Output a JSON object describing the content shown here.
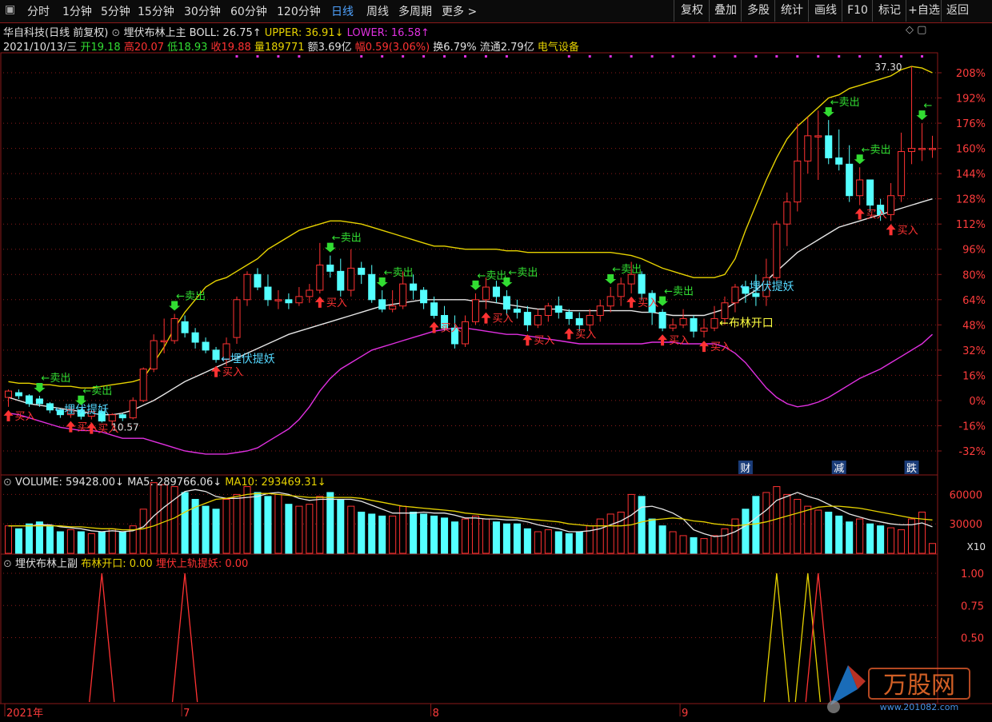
{
  "toolbar": {
    "periods": [
      "分时",
      "1分钟",
      "5分钟",
      "15分钟",
      "30分钟",
      "60分钟",
      "120分钟",
      "日线",
      "周线",
      "多周期",
      "更多 >"
    ],
    "active": "日线",
    "right": [
      "复权",
      "叠加",
      "多股",
      "统计",
      "画线",
      "F10",
      "标记",
      "+自选",
      "返回"
    ]
  },
  "header": {
    "stock": "华自科技(日线 前复权)",
    "indicator": "埋伏布林上主",
    "boll": "BOLL: 26.75↑",
    "upper": "UPPER: 36.91↓",
    "lower": "LOWER: 16.58↑",
    "date": "2021/10/13/三",
    "open": "开19.18",
    "high": "高20.07",
    "low": "低18.93",
    "close": "收19.88",
    "vol": "量189771",
    "amount": "额3.69亿",
    "change": "幅0.59(3.06%)",
    "turnover": "换6.79%",
    "float": "流通2.79亿",
    "sector": "电气设备"
  },
  "volume_header": {
    "volume": "VOLUME: 59428.00↓",
    "ma5": "MA5: 289766.06↓",
    "ma10": "MA10: 293469.31↓"
  },
  "sub_header": {
    "name": "埋伏布林上副",
    "a": "布林开口: 0.00",
    "b": "埋伏上轨提妖: 0.00"
  },
  "colors": {
    "up": "#ff3232",
    "down": "#54ffff",
    "upper": "#e6d200",
    "mid": "#e6e6e6",
    "lower": "#e030e0",
    "sell": "#32dc32",
    "buy": "#ff3232",
    "hint": "#54d8ff",
    "grid": "#8b1a1a"
  },
  "chart_data": {
    "type": "candlestick",
    "y_axis_labels": [
      "208%",
      "192%",
      "176%",
      "160%",
      "144%",
      "128%",
      "112%",
      "96%",
      "80%",
      "64%",
      "48%",
      "32%",
      "16%",
      "0%",
      "-16%",
      "-32%"
    ],
    "y_range_pct": [
      -32,
      208
    ],
    "x_labels": [
      "2021年",
      "7",
      "8",
      "9"
    ],
    "hi_mark": "37.30",
    "lo_mark": "10.57",
    "candles": [
      [
        2,
        6,
        -4,
        7
      ],
      [
        5,
        3,
        1,
        7
      ],
      [
        3,
        -2,
        -4,
        4
      ],
      [
        1,
        -2,
        -4,
        3
      ],
      [
        -2,
        -6,
        -8,
        -1
      ],
      [
        -6,
        -9,
        -11,
        -5
      ],
      [
        -9,
        -6,
        -11,
        -4
      ],
      [
        -6,
        -10,
        -12,
        -5
      ],
      [
        -10,
        -7,
        -12,
        -6
      ],
      [
        -7,
        -13,
        -14,
        -6
      ],
      [
        -13,
        -9,
        -15,
        -8
      ],
      [
        -9,
        -11,
        -13,
        -8
      ],
      [
        -11,
        0,
        -12,
        2
      ],
      [
        0,
        20,
        -1,
        21
      ],
      [
        20,
        38,
        18,
        42
      ],
      [
        38,
        38,
        30,
        52
      ],
      [
        38,
        52,
        36,
        55
      ],
      [
        50,
        43,
        40,
        54
      ],
      [
        43,
        37,
        33,
        46
      ],
      [
        37,
        32,
        30,
        40
      ],
      [
        32,
        26,
        24,
        34
      ],
      [
        26,
        36,
        22,
        40
      ],
      [
        40,
        64,
        36,
        66
      ],
      [
        64,
        80,
        60,
        82
      ],
      [
        80,
        72,
        70,
        84
      ],
      [
        72,
        64,
        60,
        80
      ],
      [
        64,
        64,
        58,
        70
      ],
      [
        64,
        62,
        58,
        68
      ],
      [
        62,
        66,
        60,
        72
      ],
      [
        66,
        70,
        62,
        74
      ],
      [
        70,
        86,
        68,
        100
      ],
      [
        86,
        82,
        78,
        92
      ],
      [
        82,
        70,
        66,
        90
      ],
      [
        70,
        84,
        66,
        96
      ],
      [
        84,
        80,
        74,
        88
      ],
      [
        80,
        64,
        62,
        86
      ],
      [
        64,
        58,
        56,
        70
      ],
      [
        58,
        60,
        56,
        70
      ],
      [
        60,
        74,
        58,
        82
      ],
      [
        74,
        70,
        64,
        80
      ],
      [
        70,
        62,
        58,
        72
      ],
      [
        62,
        54,
        52,
        66
      ],
      [
        54,
        46,
        44,
        60
      ],
      [
        46,
        36,
        33,
        54
      ],
      [
        36,
        50,
        34,
        54
      ],
      [
        50,
        64,
        48,
        68
      ],
      [
        64,
        72,
        58,
        78
      ],
      [
        72,
        66,
        62,
        76
      ],
      [
        66,
        58,
        54,
        70
      ],
      [
        58,
        56,
        52,
        64
      ],
      [
        56,
        48,
        44,
        60
      ],
      [
        48,
        54,
        46,
        58
      ],
      [
        54,
        60,
        50,
        62
      ],
      [
        60,
        56,
        52,
        66
      ],
      [
        56,
        52,
        48,
        58
      ],
      [
        52,
        48,
        44,
        56
      ],
      [
        48,
        54,
        44,
        58
      ],
      [
        54,
        60,
        50,
        64
      ],
      [
        60,
        66,
        56,
        72
      ],
      [
        66,
        74,
        60,
        78
      ],
      [
        74,
        80,
        68,
        88
      ],
      [
        80,
        68,
        64,
        82
      ],
      [
        68,
        56,
        48,
        70
      ],
      [
        56,
        46,
        44,
        58
      ],
      [
        46,
        48,
        44,
        52
      ],
      [
        48,
        52,
        46,
        58
      ],
      [
        52,
        44,
        40,
        54
      ],
      [
        44,
        46,
        40,
        52
      ],
      [
        46,
        52,
        44,
        60
      ],
      [
        52,
        62,
        48,
        66
      ],
      [
        62,
        72,
        56,
        74
      ],
      [
        72,
        68,
        62,
        76
      ],
      [
        68,
        66,
        60,
        80
      ],
      [
        66,
        78,
        60,
        90
      ],
      [
        78,
        112,
        76,
        114
      ],
      [
        112,
        126,
        98,
        132
      ],
      [
        126,
        152,
        120,
        176
      ],
      [
        152,
        168,
        144,
        180
      ],
      [
        168,
        168,
        140,
        184
      ],
      [
        168,
        154,
        150,
        178
      ],
      [
        154,
        150,
        146,
        172
      ],
      [
        150,
        130,
        126,
        162
      ],
      [
        130,
        140,
        124,
        148
      ],
      [
        140,
        124,
        120,
        132
      ],
      [
        124,
        118,
        114,
        128
      ],
      [
        118,
        130,
        114,
        138
      ],
      [
        130,
        158,
        126,
        170
      ],
      [
        158,
        160,
        150,
        212
      ],
      [
        160,
        160,
        152,
        176
      ],
      [
        160,
        160,
        154,
        168
      ]
    ],
    "upper": [
      12,
      11,
      11,
      10,
      10,
      9,
      9,
      8,
      8,
      9,
      10,
      11,
      12,
      14,
      24,
      34,
      46,
      56,
      64,
      72,
      76,
      78,
      82,
      86,
      90,
      96,
      100,
      104,
      108,
      110,
      112,
      114,
      114,
      113,
      112,
      110,
      108,
      106,
      104,
      102,
      100,
      98,
      98,
      97,
      96,
      96,
      96,
      96,
      95,
      95,
      94,
      94,
      94,
      94,
      94,
      94,
      94,
      94,
      94,
      93,
      92,
      90,
      87,
      84,
      82,
      80,
      78,
      78,
      78,
      80,
      90,
      108,
      124,
      140,
      154,
      166,
      174,
      180,
      186,
      192,
      194,
      198,
      200,
      202,
      204,
      206,
      210,
      212,
      211,
      208
    ],
    "mid": [
      2,
      0,
      -2,
      -3,
      -4,
      -5,
      -6,
      -7,
      -8,
      -9,
      -9,
      -8,
      -6,
      -3,
      0,
      4,
      8,
      12,
      15,
      18,
      21,
      24,
      27,
      30,
      33,
      36,
      39,
      42,
      44,
      46,
      48,
      50,
      52,
      54,
      56,
      58,
      60,
      61,
      62,
      63,
      64,
      64,
      64,
      64,
      64,
      63,
      63,
      62,
      61,
      60,
      59,
      58,
      58,
      58,
      57,
      57,
      57,
      57,
      57,
      57,
      57,
      56,
      56,
      55,
      54,
      54,
      54,
      54,
      56,
      58,
      62,
      66,
      70,
      76,
      82,
      88,
      94,
      98,
      102,
      106,
      110,
      112,
      114,
      116,
      118,
      120,
      122,
      124,
      126,
      128
    ],
    "lower": [
      -8,
      -9,
      -11,
      -13,
      -15,
      -17,
      -18,
      -19,
      -19,
      -20,
      -22,
      -24,
      -24,
      -24,
      -26,
      -28,
      -30,
      -32,
      -33,
      -34,
      -34,
      -34,
      -33,
      -32,
      -30,
      -26,
      -22,
      -18,
      -12,
      -4,
      6,
      14,
      20,
      24,
      28,
      32,
      34,
      36,
      38,
      40,
      42,
      44,
      45,
      46,
      46,
      45,
      44,
      43,
      42,
      42,
      41,
      40,
      39,
      38,
      37,
      36,
      36,
      36,
      36,
      36,
      36,
      36,
      37,
      37,
      37,
      36,
      36,
      36,
      36,
      34,
      30,
      24,
      16,
      8,
      2,
      -2,
      -4,
      -3,
      -1,
      2,
      6,
      10,
      14,
      17,
      20,
      24,
      28,
      32,
      36,
      42
    ],
    "signals": [
      {
        "i": 3,
        "t": "sell",
        "label": "←卖出"
      },
      {
        "i": 0,
        "t": "buy",
        "label": "买入"
      },
      {
        "i": 4,
        "t": "hint",
        "label": "←埋伏提妖"
      },
      {
        "i": 7,
        "t": "sell",
        "label": "←卖出"
      },
      {
        "i": 6,
        "t": "buy",
        "label": "买入"
      },
      {
        "i": 8,
        "t": "buy",
        "label": "买入"
      },
      {
        "i": 16,
        "t": "sell",
        "label": "←卖出"
      },
      {
        "i": 20,
        "t": "hint",
        "label": "←埋伏提妖"
      },
      {
        "i": 20,
        "t": "buy",
        "label": "买入"
      },
      {
        "i": 31,
        "t": "sell",
        "label": "←卖出"
      },
      {
        "i": 30,
        "t": "buy",
        "label": "买入"
      },
      {
        "i": 36,
        "t": "sell",
        "label": "←卖出"
      },
      {
        "i": 41,
        "t": "buy",
        "label": "买入"
      },
      {
        "i": 45,
        "t": "sell",
        "label": "←卖出"
      },
      {
        "i": 46,
        "t": "buy",
        "label": "买入"
      },
      {
        "i": 48,
        "t": "sell",
        "label": "←卖出"
      },
      {
        "i": 50,
        "t": "buy",
        "label": "买入"
      },
      {
        "i": 54,
        "t": "buy",
        "label": "买入"
      },
      {
        "i": 58,
        "t": "sell",
        "label": "←卖出"
      },
      {
        "i": 60,
        "t": "buy",
        "label": "买入"
      },
      {
        "i": 63,
        "t": "sell",
        "label": "←卖出"
      },
      {
        "i": 63,
        "t": "buy",
        "label": "买入"
      },
      {
        "i": 67,
        "t": "buy",
        "label": "买入"
      },
      {
        "i": 68,
        "t": "yellow",
        "label": "←布林开口"
      },
      {
        "i": 70,
        "t": "hint",
        "label": "←埋伏提妖"
      },
      {
        "i": 79,
        "t": "sell",
        "label": "←卖出"
      },
      {
        "i": 82,
        "t": "sell",
        "label": "←卖出"
      },
      {
        "i": 82,
        "t": "buy",
        "label": "买入"
      },
      {
        "i": 85,
        "t": "buy",
        "label": "买入"
      },
      {
        "i": 88,
        "t": "sell",
        "label": "←"
      }
    ],
    "badges": [
      {
        "i": 71,
        "label": "财"
      },
      {
        "i": 80,
        "label": "减"
      },
      {
        "i": 87,
        "label": "跌"
      }
    ],
    "volume": {
      "y_labels": [
        "60000",
        "30000"
      ],
      "unit": "X10",
      "values": [
        28,
        25,
        30,
        32,
        28,
        22,
        24,
        22,
        20,
        22,
        25,
        22,
        28,
        45,
        72,
        70,
        68,
        62,
        55,
        48,
        45,
        55,
        60,
        68,
        62,
        58,
        60,
        50,
        48,
        50,
        58,
        62,
        55,
        48,
        42,
        40,
        38,
        38,
        48,
        42,
        40,
        38,
        36,
        32,
        35,
        38,
        35,
        32,
        30,
        30,
        25,
        22,
        24,
        22,
        20,
        22,
        28,
        35,
        40,
        42,
        60,
        58,
        35,
        28,
        22,
        18,
        16,
        15,
        18,
        25,
        35,
        45,
        58,
        62,
        68,
        60,
        55,
        48,
        44,
        42,
        38,
        32,
        35,
        30,
        28,
        26,
        24,
        35,
        42,
        10
      ],
      "ma5": [
        28,
        28,
        28,
        29,
        29,
        27,
        26,
        25,
        23,
        22,
        23,
        22,
        23,
        27,
        38,
        47,
        55,
        63,
        65,
        63,
        58,
        56,
        56,
        57,
        58,
        61,
        62,
        60,
        56,
        54,
        55,
        55,
        55,
        55,
        53,
        49,
        45,
        41,
        41,
        41,
        42,
        41,
        41,
        39,
        36,
        36,
        35,
        35,
        34,
        34,
        32,
        29,
        27,
        25,
        22,
        22,
        23,
        25,
        29,
        33,
        39,
        47,
        48,
        45,
        41,
        35,
        24,
        20,
        17,
        18,
        22,
        28,
        36,
        44,
        54,
        58,
        62,
        58,
        55,
        50,
        45,
        40,
        37,
        34,
        32,
        30,
        29,
        29,
        31,
        27
      ],
      "ma10": [
        28,
        28,
        28,
        28,
        28,
        28,
        27,
        27,
        26,
        25,
        25,
        24,
        24,
        25,
        28,
        32,
        36,
        42,
        47,
        51,
        55,
        56,
        58,
        60,
        61,
        61,
        60,
        59,
        58,
        57,
        57,
        57,
        57,
        57,
        56,
        54,
        52,
        50,
        48,
        47,
        46,
        45,
        44,
        43,
        41,
        40,
        39,
        38,
        37,
        36,
        35,
        34,
        33,
        32,
        30,
        29,
        28,
        28,
        28,
        28,
        29,
        32,
        34,
        35,
        36,
        35,
        33,
        32,
        30,
        29,
        28,
        29,
        30,
        32,
        35,
        38,
        41,
        44,
        47,
        48,
        48,
        47,
        46,
        44,
        42,
        40,
        38,
        36,
        35,
        34
      ]
    },
    "sub": {
      "y_labels": [
        "1.00",
        "0.75",
        "0.50"
      ],
      "yellow_spikes": [
        74,
        77
      ],
      "red_spikes": [
        9,
        17,
        78
      ]
    }
  }
}
